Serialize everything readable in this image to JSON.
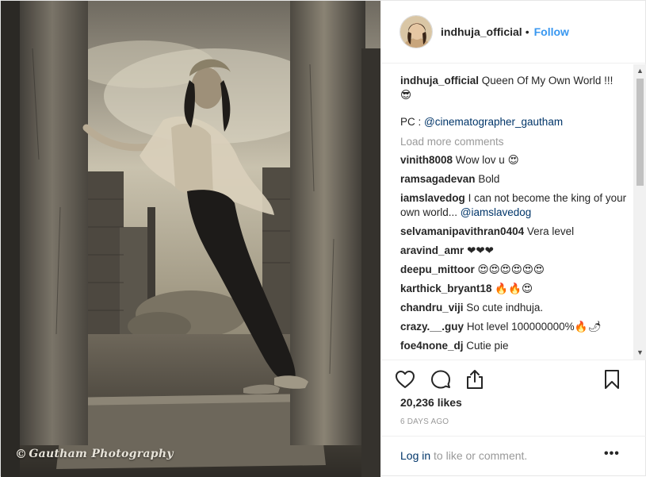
{
  "photo": {
    "alt": "indhuja_official post photo",
    "watermark_mark": "©",
    "watermark_text": "Gautham Photography"
  },
  "header": {
    "username": "indhuja_official",
    "separator": "•",
    "follow_label": "Follow"
  },
  "caption": {
    "username": "indhuja_official",
    "text": "Queen Of My Own World !!! 😎",
    "pc_prefix": "PC : ",
    "pc_mention": "@cinematographer_gautham"
  },
  "load_more_label": "Load more comments",
  "comments": [
    {
      "user": "vinith8008",
      "text": "Wow lov u 😍",
      "mention": ""
    },
    {
      "user": "ramsagadevan",
      "text": "Bold",
      "mention": ""
    },
    {
      "user": "iamslavedog",
      "text": "I can not become the king of your own world... ",
      "mention": "@iamslavedog"
    },
    {
      "user": "selvamanipavithran0404",
      "text": "Vera level",
      "mention": ""
    },
    {
      "user": "aravind_amr",
      "text": "❤❤❤",
      "mention": ""
    },
    {
      "user": "deepu_mittoor",
      "text": "😍😍😍😍😍😍",
      "mention": ""
    },
    {
      "user": "karthick_bryant18",
      "text": "🔥🔥😍",
      "mention": ""
    },
    {
      "user": "chandru_viji",
      "text": "So cute indhuja.",
      "mention": ""
    },
    {
      "user": "crazy.__.guy",
      "text": "Hot level 100000000%🔥🌶",
      "mention": ""
    },
    {
      "user": "foe4none_dj",
      "text": "Cutie pie",
      "mention": ""
    }
  ],
  "scrollbar": {
    "up_glyph": "▲",
    "down_glyph": "▼"
  },
  "actions": {
    "icons": [
      "heart-icon",
      "comment-icon",
      "share-icon",
      "bookmark-icon"
    ]
  },
  "likes_label": "20,236 likes",
  "time_label": "6 DAYS AGO",
  "footer": {
    "login_label": "Log in",
    "login_suffix": " to like or comment.",
    "more_label": "•••"
  },
  "colors": {
    "link_blue": "#3897f0",
    "mention_blue": "#003569",
    "muted_gray": "#999999",
    "text": "#262626",
    "border": "#efefef"
  }
}
